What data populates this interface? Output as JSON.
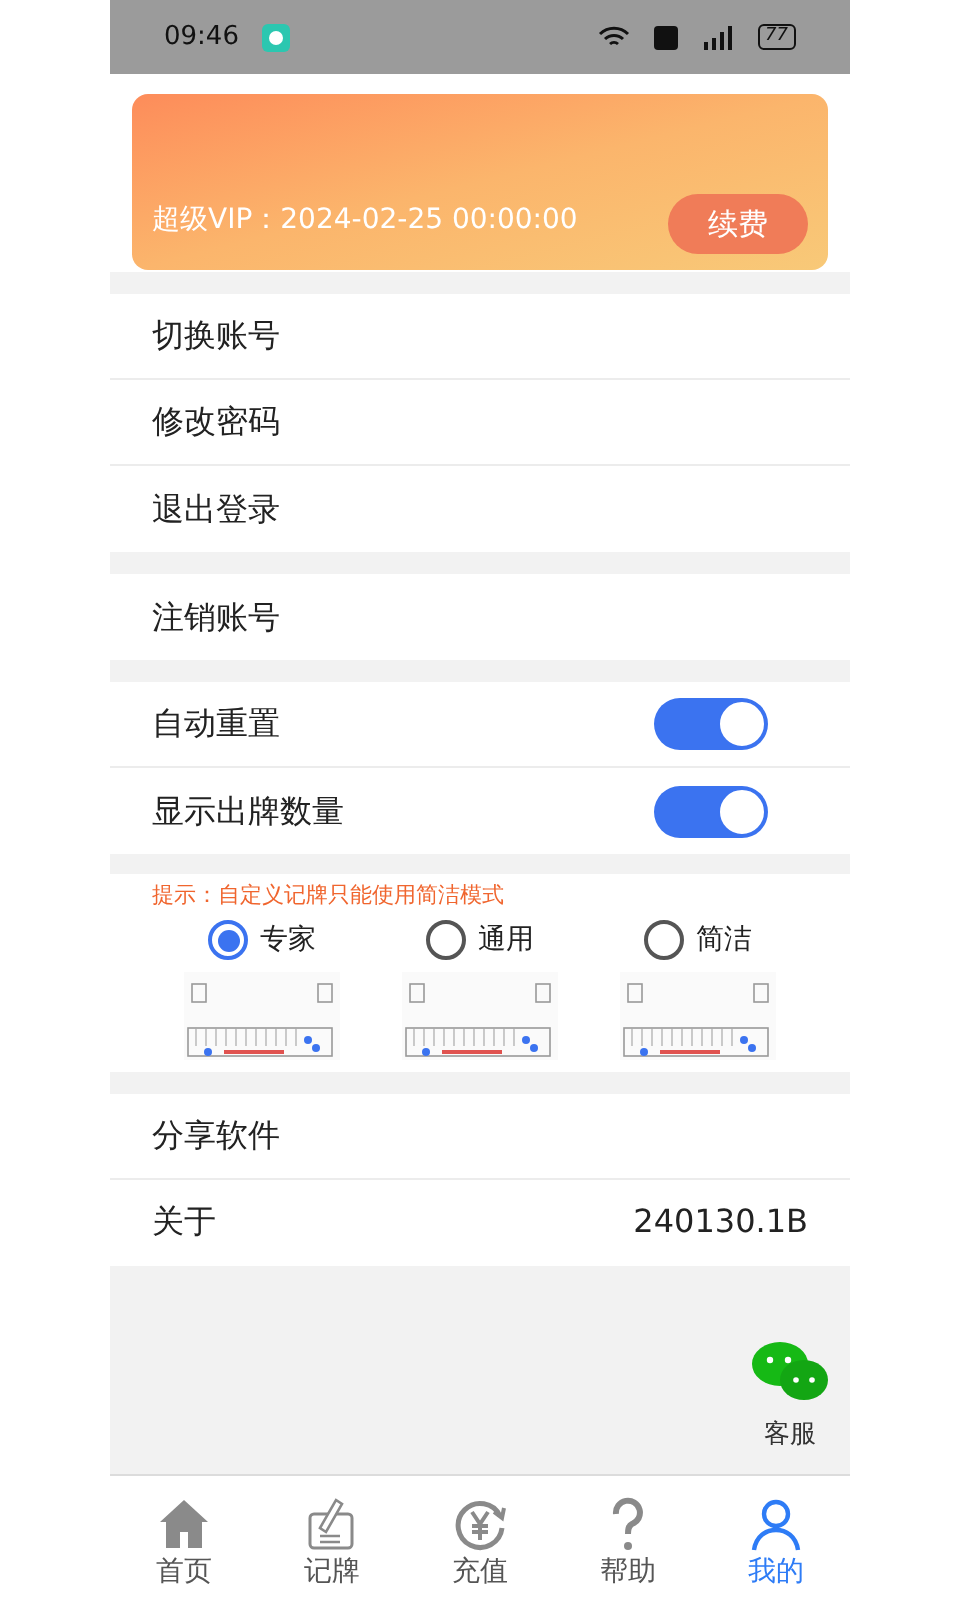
{
  "status_bar": {
    "time": "09:46",
    "battery": "77"
  },
  "vip_card": {
    "label": "超级VIP：2024-02-25 00:00:00",
    "button": "续费"
  },
  "groups": [
    [
      {
        "kind": "link",
        "label": "切换账号"
      },
      {
        "kind": "link",
        "label": "修改密码"
      },
      {
        "kind": "link",
        "label": "退出登录"
      }
    ],
    [
      {
        "kind": "link",
        "label": "注销账号"
      }
    ],
    [
      {
        "kind": "toggle",
        "label": "自动重置",
        "on": true
      },
      {
        "kind": "toggle",
        "label": "显示出牌数量",
        "on": true
      }
    ]
  ],
  "mode": {
    "hint": "提示：自定义记牌只能使用简洁模式",
    "options": [
      {
        "label": "专家",
        "selected": true
      },
      {
        "label": "通用",
        "selected": false
      },
      {
        "label": "简洁",
        "selected": false
      }
    ]
  },
  "groups2": [
    [
      {
        "kind": "link",
        "label": "分享软件"
      },
      {
        "kind": "value",
        "label": "关于",
        "value": "240130.1B"
      }
    ]
  ],
  "support": {
    "label": "客服"
  },
  "tabs": [
    {
      "label": "首页",
      "kind": "home",
      "selected": false
    },
    {
      "label": "记牌",
      "kind": "note",
      "selected": false
    },
    {
      "label": "充值",
      "kind": "yen",
      "selected": false
    },
    {
      "label": "帮助",
      "kind": "help",
      "selected": false
    },
    {
      "label": "我的",
      "kind": "user",
      "selected": true
    }
  ]
}
